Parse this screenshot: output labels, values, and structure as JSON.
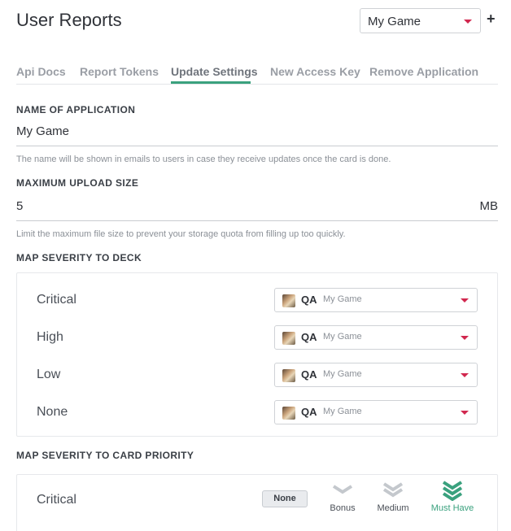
{
  "header": {
    "title": "User Reports",
    "app_selector": {
      "selected": "My Game"
    },
    "add_label": "+"
  },
  "tabs": [
    {
      "label": "Api Docs"
    },
    {
      "label": "Report Tokens"
    },
    {
      "label": "Update Settings",
      "active": true
    },
    {
      "label": "New Access Key"
    },
    {
      "label": "Remove Application"
    }
  ],
  "name_field": {
    "label": "NAME OF APPLICATION",
    "value": "My Game",
    "hint": "The name will be shown in emails to users in case they receive updates once the card is done."
  },
  "upload_field": {
    "label": "MAXIMUM UPLOAD SIZE",
    "value": "5",
    "unit": "MB",
    "hint": "Limit the maximum file size to prevent your storage quota from filling up too quickly."
  },
  "severity_deck": {
    "label": "MAP SEVERITY TO DECK",
    "rows": [
      {
        "severity": "Critical",
        "deck": "QA",
        "project": "My Game"
      },
      {
        "severity": "High",
        "deck": "QA",
        "project": "My Game"
      },
      {
        "severity": "Low",
        "deck": "QA",
        "project": "My Game"
      },
      {
        "severity": "None",
        "deck": "QA",
        "project": "My Game"
      }
    ]
  },
  "severity_priority": {
    "label": "MAP SEVERITY TO CARD PRIORITY",
    "rows": [
      {
        "severity": "Critical",
        "none_label": "None",
        "options": [
          {
            "label": "Bonus",
            "icon": "single-chevron-down-icon"
          },
          {
            "label": "Medium",
            "icon": "double-chevron-down-icon"
          },
          {
            "label": "Must Have",
            "icon": "triple-chevron-down-icon",
            "selected": true
          }
        ]
      }
    ]
  },
  "colors": {
    "accent": "#3aa17e",
    "caret": "#d1274e",
    "muted_icon": "#c4c8cd"
  }
}
